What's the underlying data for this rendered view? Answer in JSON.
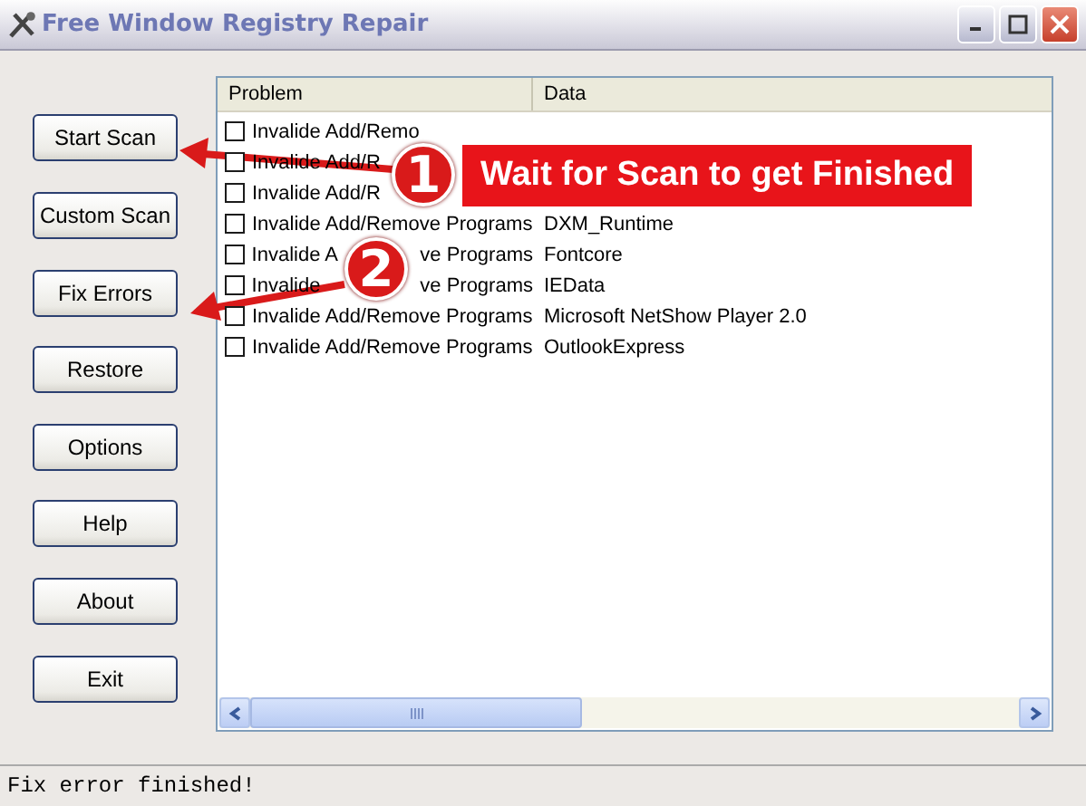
{
  "window": {
    "title": "Free Window Registry Repair"
  },
  "buttons": [
    {
      "label": "Start Scan"
    },
    {
      "label": "Custom Scan"
    },
    {
      "label": "Fix Errors"
    },
    {
      "label": "Restore"
    },
    {
      "label": "Options"
    },
    {
      "label": "Help"
    },
    {
      "label": "About"
    },
    {
      "label": "Exit"
    }
  ],
  "table": {
    "columns": [
      "Problem",
      "Data"
    ],
    "rows": [
      {
        "checked": false,
        "problem": "Invalide Add/Remo"
      },
      {
        "checked": false,
        "problem": "Invalide Add/R"
      },
      {
        "checked": false,
        "problem": "Invalide Add/R"
      },
      {
        "checked": false,
        "problem": "Invalide Add/Remove Programs",
        "data": "DXM_Runtime"
      },
      {
        "checked": false,
        "problem": [
          "Invalide A",
          "ve Programs"
        ],
        "data": "Fontcore"
      },
      {
        "checked": false,
        "problem": [
          "Invalide",
          "ve Programs"
        ],
        "data": "IEData"
      },
      {
        "checked": false,
        "problem": "Invalide Add/Remove Programs",
        "data": "Microsoft NetShow Player 2.0"
      },
      {
        "checked": false,
        "problem": "Invalide Add/Remove Programs",
        "data": "OutlookExpress"
      }
    ]
  },
  "annotations": [
    {
      "number": "1",
      "text": "Wait for Scan to get Finished"
    },
    {
      "number": "2"
    }
  ],
  "status_bar": "Fix error finished!"
}
